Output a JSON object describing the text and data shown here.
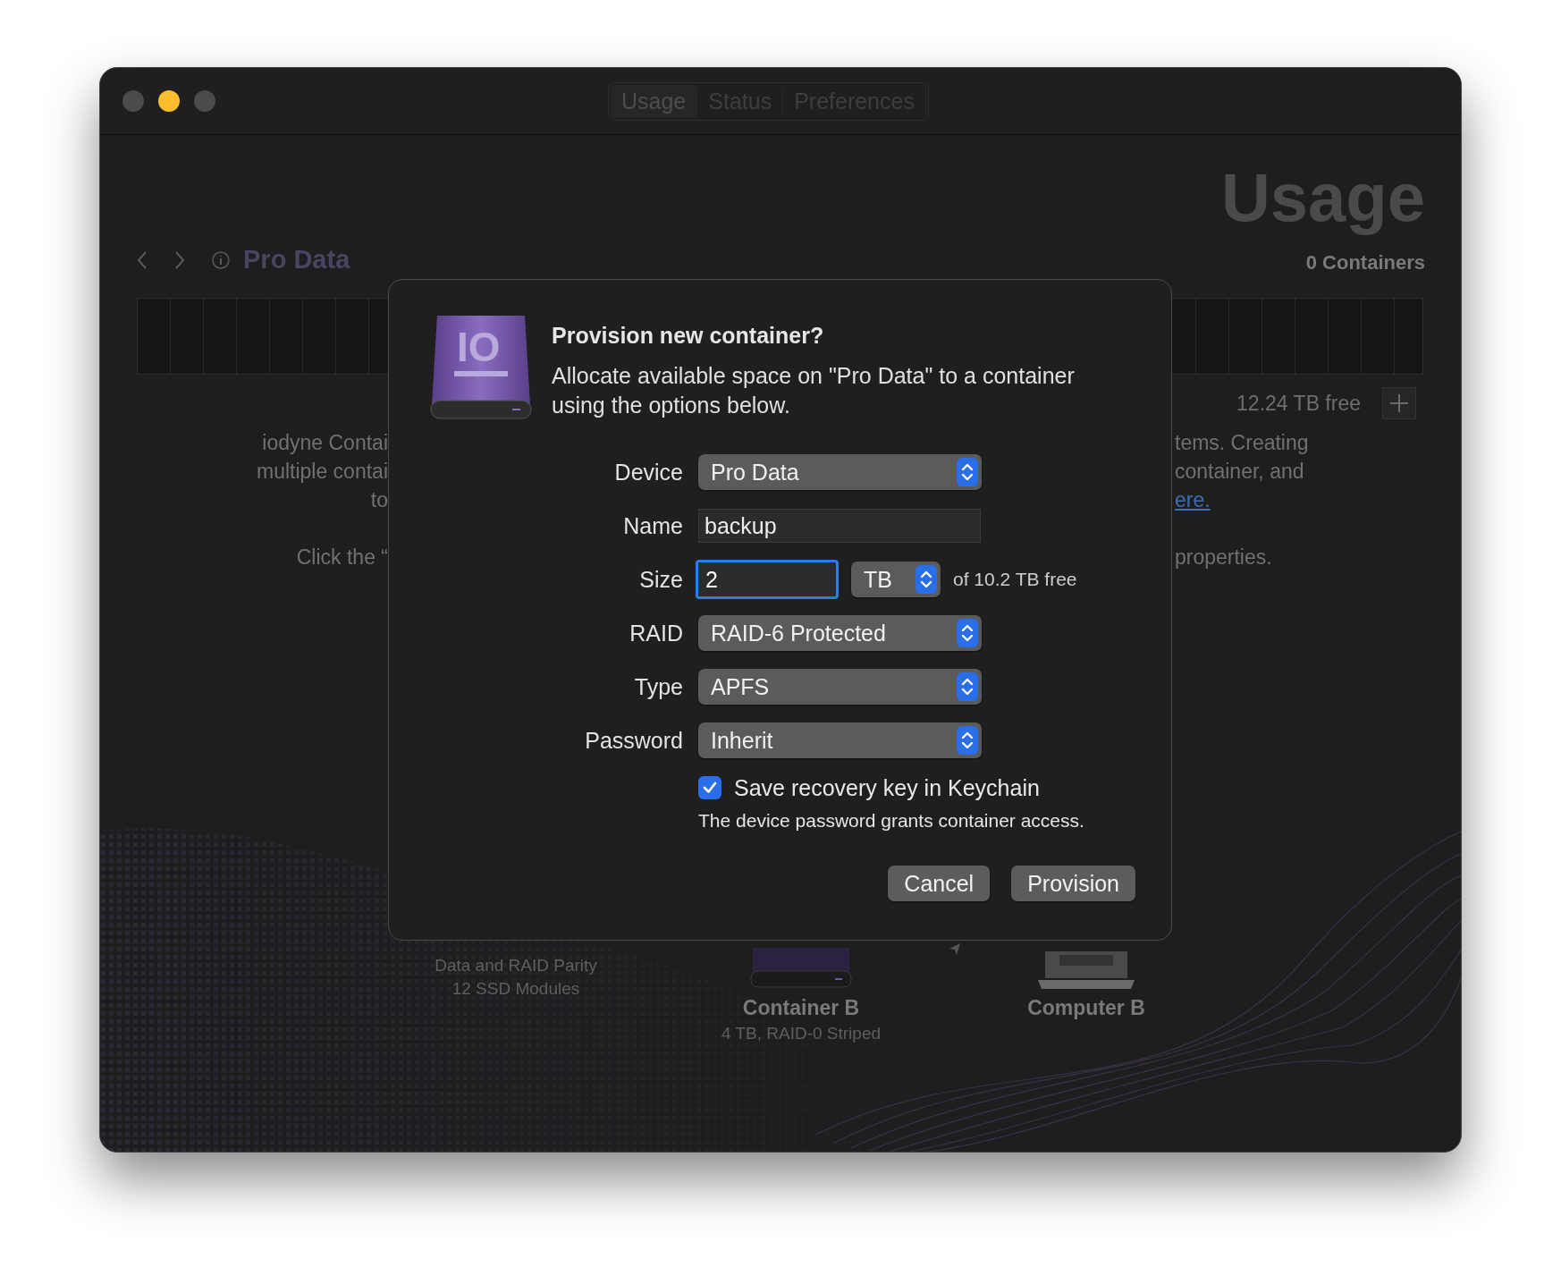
{
  "window": {
    "traffic_lights": [
      {
        "color": "#4b4b4b"
      },
      {
        "color": "#febc2e"
      },
      {
        "color": "#4b4b4b"
      }
    ],
    "tabs": [
      {
        "label": "Usage",
        "selected": true
      },
      {
        "label": "Status",
        "selected": false
      },
      {
        "label": "Preferences",
        "selected": false
      }
    ]
  },
  "header": {
    "device": "Pro Data",
    "title": "Usage",
    "count": "0 Containers"
  },
  "storage": {
    "free": "12.24 TB free"
  },
  "description": {
    "left_paragraphs": [
      [
        "iodyne Contai",
        "multiple contai",
        "to"
      ],
      [
        "Click the “"
      ]
    ],
    "right_paragraphs": [
      [
        {
          "kind": "text",
          "text": "tems. Creating"
        },
        {
          "kind": "text",
          "text": "container, and"
        },
        {
          "kind": "link",
          "text": "ere."
        }
      ],
      [
        {
          "kind": "text",
          "text": "properties."
        }
      ]
    ]
  },
  "diagram": {
    "items": [
      {
        "kind": "array",
        "details": [
          "Data and RAID Parity",
          "12 SSD Modules"
        ]
      },
      {
        "kind": "drive",
        "name": "Container B",
        "details": [
          "4 TB, RAID-0 Striped"
        ]
      },
      {
        "kind": "computer",
        "name": "Computer B"
      }
    ]
  },
  "dialog": {
    "icon_text": "IO",
    "title": "Provision new container?",
    "message": "Allocate available space on \"Pro Data\" to a container using the options below.",
    "fields": [
      {
        "kind": "popup",
        "label": "Device",
        "value": "Pro Data"
      },
      {
        "kind": "text",
        "label": "Name",
        "value": "backup"
      },
      {
        "kind": "size",
        "label": "Size",
        "value": "2",
        "focused": true,
        "unit": "TB",
        "note": "of 10.2 TB free"
      },
      {
        "kind": "popup",
        "label": "RAID",
        "value": "RAID-6 Protected"
      },
      {
        "kind": "popup",
        "label": "Type",
        "value": "APFS"
      },
      {
        "kind": "popup",
        "label": "Password",
        "value": "Inherit"
      }
    ],
    "checkbox": {
      "label": "Save recovery key in Keychain",
      "checked": true
    },
    "note": "The device password grants container access.",
    "buttons": [
      "Cancel",
      "Provision"
    ]
  }
}
